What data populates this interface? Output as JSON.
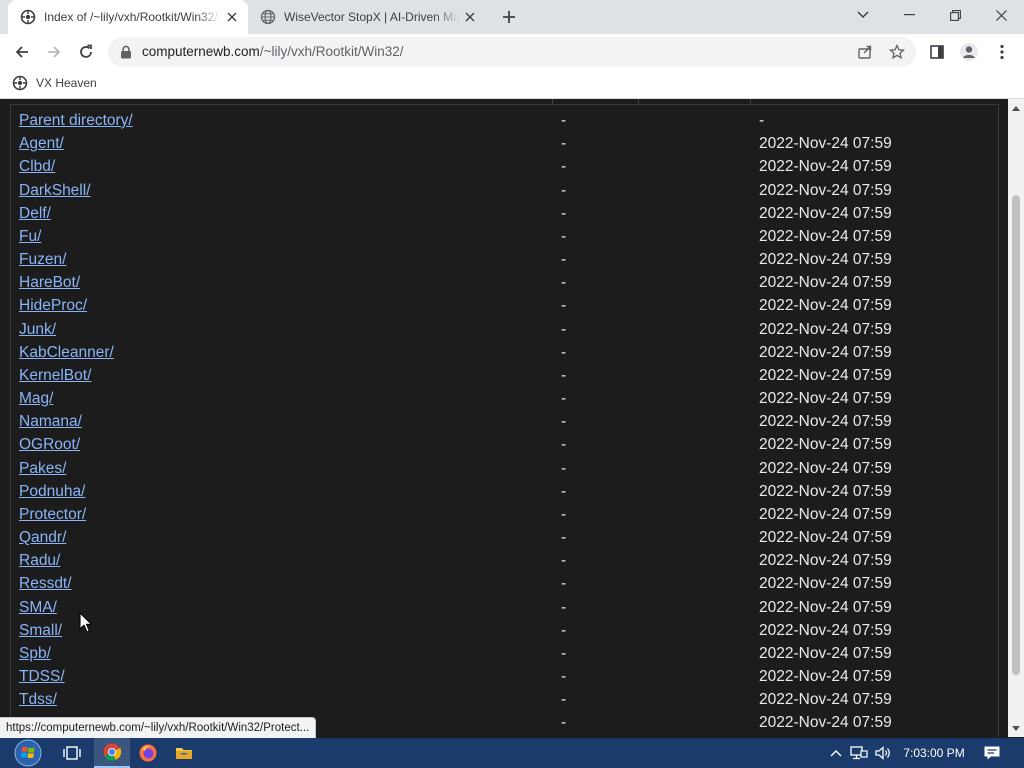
{
  "tabs": [
    {
      "title": "Index of /~lily/vxh/Rootkit/Win32/",
      "active": true
    },
    {
      "title": "WiseVector StopX | AI-Driven Malware Protection",
      "active": false
    }
  ],
  "address_bar": {
    "host": "computernewb.com",
    "path": "/~lily/vxh/Rootkit/Win32/"
  },
  "bookmarks": [
    {
      "label": "VX Heaven"
    }
  ],
  "listing": {
    "rows": [
      {
        "name": "Parent directory/",
        "size": "-",
        "date": "-"
      },
      {
        "name": "Agent/",
        "size": "-",
        "date": "2022-Nov-24 07:59"
      },
      {
        "name": "Clbd/",
        "size": "-",
        "date": "2022-Nov-24 07:59"
      },
      {
        "name": "DarkShell/",
        "size": "-",
        "date": "2022-Nov-24 07:59"
      },
      {
        "name": "Delf/",
        "size": "-",
        "date": "2022-Nov-24 07:59"
      },
      {
        "name": "Fu/",
        "size": "-",
        "date": "2022-Nov-24 07:59"
      },
      {
        "name": "Fuzen/",
        "size": "-",
        "date": "2022-Nov-24 07:59"
      },
      {
        "name": "HareBot/",
        "size": "-",
        "date": "2022-Nov-24 07:59"
      },
      {
        "name": "HideProc/",
        "size": "-",
        "date": "2022-Nov-24 07:59"
      },
      {
        "name": "Junk/",
        "size": "-",
        "date": "2022-Nov-24 07:59"
      },
      {
        "name": "KabCleanner/",
        "size": "-",
        "date": "2022-Nov-24 07:59"
      },
      {
        "name": "KernelBot/",
        "size": "-",
        "date": "2022-Nov-24 07:59"
      },
      {
        "name": "Mag/",
        "size": "-",
        "date": "2022-Nov-24 07:59"
      },
      {
        "name": "Namana/",
        "size": "-",
        "date": "2022-Nov-24 07:59"
      },
      {
        "name": "OGRoot/",
        "size": "-",
        "date": "2022-Nov-24 07:59"
      },
      {
        "name": "Pakes/",
        "size": "-",
        "date": "2022-Nov-24 07:59"
      },
      {
        "name": "Podnuha/",
        "size": "-",
        "date": "2022-Nov-24 07:59"
      },
      {
        "name": "Protector/",
        "size": "-",
        "date": "2022-Nov-24 07:59"
      },
      {
        "name": "Qandr/",
        "size": "-",
        "date": "2022-Nov-24 07:59"
      },
      {
        "name": "Radu/",
        "size": "-",
        "date": "2022-Nov-24 07:59"
      },
      {
        "name": "Ressdt/",
        "size": "-",
        "date": "2022-Nov-24 07:59"
      },
      {
        "name": "SMA/",
        "size": "-",
        "date": "2022-Nov-24 07:59"
      },
      {
        "name": "Small/",
        "size": "-",
        "date": "2022-Nov-24 07:59"
      },
      {
        "name": "Spb/",
        "size": "-",
        "date": "2022-Nov-24 07:59"
      },
      {
        "name": "TDSS/",
        "size": "-",
        "date": "2022-Nov-24 07:59"
      },
      {
        "name": "Tdss/",
        "size": "-",
        "date": "2022-Nov-24 07:59"
      },
      {
        "name": "",
        "size": "-",
        "date": "2022-Nov-24 07:59"
      }
    ]
  },
  "status_bar": {
    "url": "https://computernewb.com/~lily/vxh/Rootkit/Win32/Protect..."
  },
  "taskbar": {
    "time": "7:03:00 PM"
  },
  "colors": {
    "page_bg": "#1c1c1c",
    "link": "#8ab4f8",
    "text": "#e8eaed",
    "taskbar": "#1a3b6b"
  }
}
